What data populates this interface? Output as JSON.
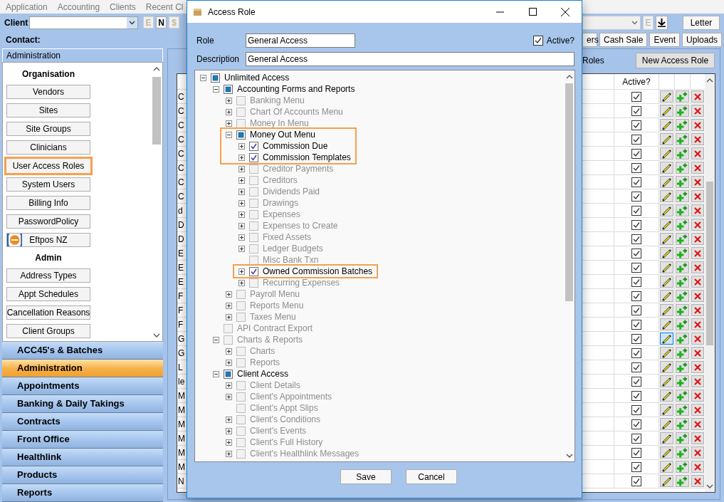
{
  "menu_bar": [
    "Application",
    "Accounting",
    "Clients",
    "Recent Cl"
  ],
  "toolbar": {
    "client_label": "Client",
    "client_buttons": [
      {
        "label": "E",
        "disabled": true
      },
      {
        "label": "N",
        "disabled": false
      },
      {
        "label": "$",
        "disabled": true
      }
    ],
    "contact_label": "Contact:",
    "right_row1": [
      {
        "kind": "combo"
      },
      {
        "kind": "text",
        "label": "E",
        "disabled": true
      },
      {
        "kind": "download",
        "disabled": false
      },
      {
        "kind": "text",
        "label": "Letter",
        "disabled": false
      }
    ],
    "right_row2": [
      "ers",
      "Cash Sale",
      "Event",
      "Uploads"
    ]
  },
  "sidebar": {
    "title": "Administration",
    "sections": [
      {
        "heading": "Organisation",
        "items": [
          {
            "label": "Vendors",
            "kind": "plain",
            "highlighted": false
          },
          {
            "label": "Sites",
            "kind": "plain",
            "highlighted": false
          },
          {
            "label": "Site Groups",
            "kind": "plain",
            "highlighted": false
          },
          {
            "label": "Clinicians",
            "kind": "plain",
            "highlighted": false
          },
          {
            "label": "User Access Roles",
            "kind": "plain",
            "highlighted": true
          },
          {
            "label": "System Users",
            "kind": "plain",
            "highlighted": false
          },
          {
            "label": "Billing Info",
            "kind": "plain",
            "highlighted": false
          },
          {
            "label": "PasswordPolicy",
            "kind": "plain",
            "highlighted": false
          },
          {
            "label": "Eftpos NZ",
            "kind": "logo",
            "highlighted": false
          }
        ]
      },
      {
        "heading": "Admin",
        "items": [
          {
            "label": "Address Types",
            "kind": "plain",
            "highlighted": false
          },
          {
            "label": "Appt Schedules",
            "kind": "plain",
            "highlighted": false
          },
          {
            "label": "Cancellation Reasons",
            "kind": "plain",
            "highlighted": false
          },
          {
            "label": "Client Groups",
            "kind": "plain",
            "highlighted": false
          }
        ]
      }
    ]
  },
  "nav": [
    {
      "label": "ACC45's & Batches",
      "selected": false
    },
    {
      "label": "Administration",
      "selected": true
    },
    {
      "label": "Appointments",
      "selected": false
    },
    {
      "label": "Banking & Daily Takings",
      "selected": false
    },
    {
      "label": "Contracts",
      "selected": false
    },
    {
      "label": "Front Office",
      "selected": false
    },
    {
      "label": "Healthlink",
      "selected": false
    },
    {
      "label": "Products",
      "selected": false
    },
    {
      "label": "Reports",
      "selected": false
    }
  ],
  "roles_panel": {
    "title": "Roles",
    "new_button": "New Access Role",
    "active_column": "Active?",
    "rows": [
      {
        "name": "C",
        "active": true,
        "focused": false
      },
      {
        "name": "C",
        "active": true,
        "focused": false
      },
      {
        "name": "C",
        "active": true,
        "focused": false
      },
      {
        "name": "C",
        "active": true,
        "focused": false
      },
      {
        "name": "C",
        "active": true,
        "focused": false
      },
      {
        "name": "C",
        "active": true,
        "focused": false
      },
      {
        "name": "C",
        "active": true,
        "focused": false
      },
      {
        "name": "C",
        "active": true,
        "focused": false
      },
      {
        "name": "d",
        "active": true,
        "focused": false
      },
      {
        "name": "D",
        "active": true,
        "focused": false
      },
      {
        "name": "D",
        "active": true,
        "focused": false
      },
      {
        "name": "E",
        "active": true,
        "focused": false
      },
      {
        "name": "E",
        "active": true,
        "focused": false
      },
      {
        "name": "E",
        "active": true,
        "focused": false
      },
      {
        "name": "F",
        "active": true,
        "focused": false
      },
      {
        "name": "F",
        "active": true,
        "focused": false
      },
      {
        "name": "F",
        "active": true,
        "focused": false
      },
      {
        "name": "G",
        "active": true,
        "focused": true
      },
      {
        "name": "G",
        "active": true,
        "focused": false
      },
      {
        "name": "L",
        "active": true,
        "focused": false
      },
      {
        "name": "le",
        "active": true,
        "focused": false
      },
      {
        "name": "M",
        "active": true,
        "focused": false
      },
      {
        "name": "M",
        "active": true,
        "focused": false
      },
      {
        "name": "M",
        "active": true,
        "focused": false
      },
      {
        "name": "M",
        "active": true,
        "focused": false
      },
      {
        "name": "M",
        "active": true,
        "focused": false
      },
      {
        "name": "M",
        "active": true,
        "focused": false
      },
      {
        "name": "N",
        "active": true,
        "focused": false
      }
    ]
  },
  "dialog": {
    "title": "Access Role",
    "role_label": "Role",
    "role_value": "General Access",
    "active_label": "Active?",
    "active": true,
    "description_label": "Description",
    "description_value": "General Access",
    "tree": [
      {
        "label": "Unlimited Access",
        "checked": false,
        "indeterminate": true,
        "disabled": false,
        "highlighted": false,
        "expanded": true,
        "children": [
          {
            "label": "Accounting Forms and Reports",
            "checked": false,
            "indeterminate": true,
            "disabled": false,
            "highlighted": false,
            "expanded": true,
            "children": [
              {
                "label": "Banking Menu",
                "checked": false,
                "indeterminate": false,
                "disabled": true,
                "highlighted": false,
                "expanded": false
              },
              {
                "label": "Chart Of Accounts Menu",
                "checked": false,
                "indeterminate": false,
                "disabled": true,
                "highlighted": false,
                "expanded": false
              },
              {
                "label": "Money In Menu",
                "checked": false,
                "indeterminate": false,
                "disabled": true,
                "highlighted": false,
                "expanded": false
              },
              {
                "label": "Money Out Menu",
                "checked": false,
                "indeterminate": true,
                "disabled": false,
                "highlighted": true,
                "expanded": true,
                "children": [
                  {
                    "label": "Commission Due",
                    "checked": true,
                    "indeterminate": false,
                    "disabled": false,
                    "highlighted": true,
                    "expanded": false
                  },
                  {
                    "label": "Commission Templates",
                    "checked": true,
                    "indeterminate": false,
                    "disabled": false,
                    "highlighted": true,
                    "expanded": false
                  },
                  {
                    "label": "Creditor Payments",
                    "checked": false,
                    "indeterminate": false,
                    "disabled": true,
                    "highlighted": false,
                    "expanded": false
                  },
                  {
                    "label": "Creditors",
                    "checked": false,
                    "indeterminate": false,
                    "disabled": true,
                    "highlighted": false,
                    "expanded": false
                  },
                  {
                    "label": "Dividends Paid",
                    "checked": false,
                    "indeterminate": false,
                    "disabled": true,
                    "highlighted": false,
                    "expanded": false
                  },
                  {
                    "label": "Drawings",
                    "checked": false,
                    "indeterminate": false,
                    "disabled": true,
                    "highlighted": false,
                    "expanded": false
                  },
                  {
                    "label": "Expenses",
                    "checked": false,
                    "indeterminate": false,
                    "disabled": true,
                    "highlighted": false,
                    "expanded": false
                  },
                  {
                    "label": "Expenses to Create",
                    "checked": false,
                    "indeterminate": false,
                    "disabled": true,
                    "highlighted": false,
                    "expanded": false
                  },
                  {
                    "label": "Fixed Assets",
                    "checked": false,
                    "indeterminate": false,
                    "disabled": true,
                    "highlighted": false,
                    "expanded": false
                  },
                  {
                    "label": "Ledger Budgets",
                    "checked": false,
                    "indeterminate": false,
                    "disabled": true,
                    "highlighted": false,
                    "expanded": false
                  },
                  {
                    "label": "Misc Bank Txn",
                    "checked": false,
                    "indeterminate": false,
                    "disabled": true,
                    "highlighted": false
                  },
                  {
                    "label": "Owned Commission Batches",
                    "checked": true,
                    "indeterminate": false,
                    "disabled": false,
                    "highlighted": true,
                    "expanded": false
                  },
                  {
                    "label": "Recurring Expenses",
                    "checked": false,
                    "indeterminate": false,
                    "disabled": true,
                    "highlighted": false,
                    "expanded": false
                  }
                ]
              },
              {
                "label": "Payroll Menu",
                "checked": false,
                "indeterminate": false,
                "disabled": true,
                "highlighted": false,
                "expanded": false
              },
              {
                "label": "Reports Menu",
                "checked": false,
                "indeterminate": false,
                "disabled": true,
                "highlighted": false,
                "expanded": false
              },
              {
                "label": "Taxes Menu",
                "checked": false,
                "indeterminate": false,
                "disabled": true,
                "highlighted": false,
                "expanded": false
              }
            ]
          },
          {
            "label": "API Contract Export",
            "checked": false,
            "indeterminate": false,
            "disabled": true,
            "highlighted": false
          },
          {
            "label": "Charts & Reports",
            "checked": false,
            "indeterminate": false,
            "disabled": true,
            "highlighted": false,
            "expanded": true,
            "children": [
              {
                "label": "Charts",
                "checked": false,
                "indeterminate": false,
                "disabled": true,
                "highlighted": false,
                "expanded": false
              },
              {
                "label": "Reports",
                "checked": false,
                "indeterminate": false,
                "disabled": true,
                "highlighted": false,
                "expanded": false
              }
            ]
          },
          {
            "label": "Client Access",
            "checked": false,
            "indeterminate": true,
            "disabled": false,
            "highlighted": false,
            "expanded": true,
            "children": [
              {
                "label": "Client Details",
                "checked": false,
                "indeterminate": false,
                "disabled": true,
                "highlighted": false,
                "expanded": false
              },
              {
                "label": "Client's Appointments",
                "checked": false,
                "indeterminate": false,
                "disabled": true,
                "highlighted": false,
                "expanded": false
              },
              {
                "label": "Client's Appt Slips",
                "checked": false,
                "indeterminate": false,
                "disabled": true,
                "highlighted": false
              },
              {
                "label": "Client's Conditions",
                "checked": false,
                "indeterminate": false,
                "disabled": true,
                "highlighted": false,
                "expanded": false
              },
              {
                "label": "Client's Events",
                "checked": false,
                "indeterminate": false,
                "disabled": true,
                "highlighted": false,
                "expanded": false
              },
              {
                "label": "Client's Full History",
                "checked": false,
                "indeterminate": false,
                "disabled": true,
                "highlighted": false,
                "expanded": false
              },
              {
                "label": "Client's Healthlink Messages",
                "checked": false,
                "indeterminate": false,
                "disabled": true,
                "highlighted": false,
                "expanded": false
              }
            ]
          }
        ]
      }
    ],
    "buttons": [
      "Save",
      "Cancel"
    ]
  }
}
